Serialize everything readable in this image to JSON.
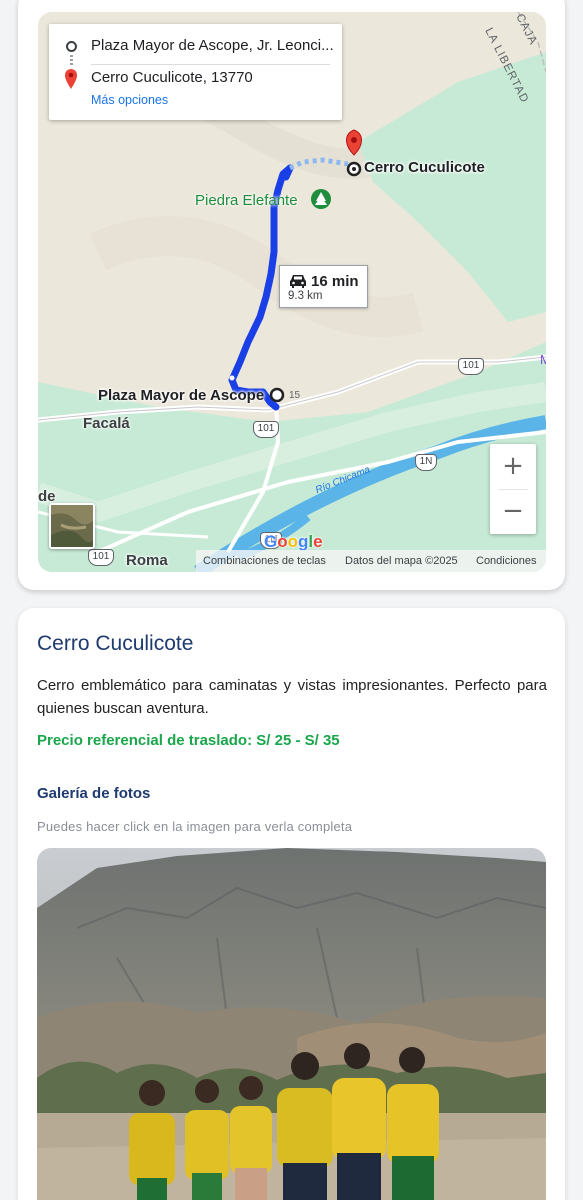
{
  "map": {
    "directions": {
      "origin": "Plaza Mayor de Ascope, Jr. Leonci...",
      "destination": "Cerro Cuculicote, 13770",
      "more_options": "Más opciones"
    },
    "labels": {
      "destination": "Cerro Cuculicote",
      "origin": "Plaza Mayor de Ascope",
      "park": "Piedra Elefante",
      "town": "Facalá",
      "partial_left": "de",
      "partial_bottom": "Roma",
      "region": "LA LIBERTAD",
      "region_top": "CAJA",
      "river": "Río Chicama",
      "edge_letter": "M"
    },
    "route": {
      "time": "16 min",
      "distance": "9.3 km"
    },
    "shields": {
      "r101_a": "101",
      "r101_b": "101",
      "r101_c": "101",
      "r1n_a": "1N",
      "r1n_b": "1N",
      "km15": "15"
    },
    "zoom": {
      "in": "+",
      "out": "−"
    },
    "google": "Google",
    "attribution": {
      "shortcuts": "Combinaciones de teclas",
      "data": "Datos del mapa ©2025",
      "terms": "Condiciones"
    },
    "colors": {
      "route": "#1a3fe6",
      "land": "#ece7db",
      "green": "#bfe6cf",
      "water": "#5ab4e8",
      "pin": "#ea4335"
    }
  },
  "place": {
    "title": "Cerro Cuculicote",
    "description": "Cerro emblemático para caminatas y vistas impresionantes. Perfecto para quienes buscan aventura.",
    "price": "Precio referencial de traslado: S/ 25 - S/ 35",
    "gallery_title": "Galería de fotos",
    "gallery_hint": "Puedes hacer click en la imagen para verla completa"
  },
  "colors": {
    "title": "#1e3a6e",
    "price": "#1aa64a"
  }
}
